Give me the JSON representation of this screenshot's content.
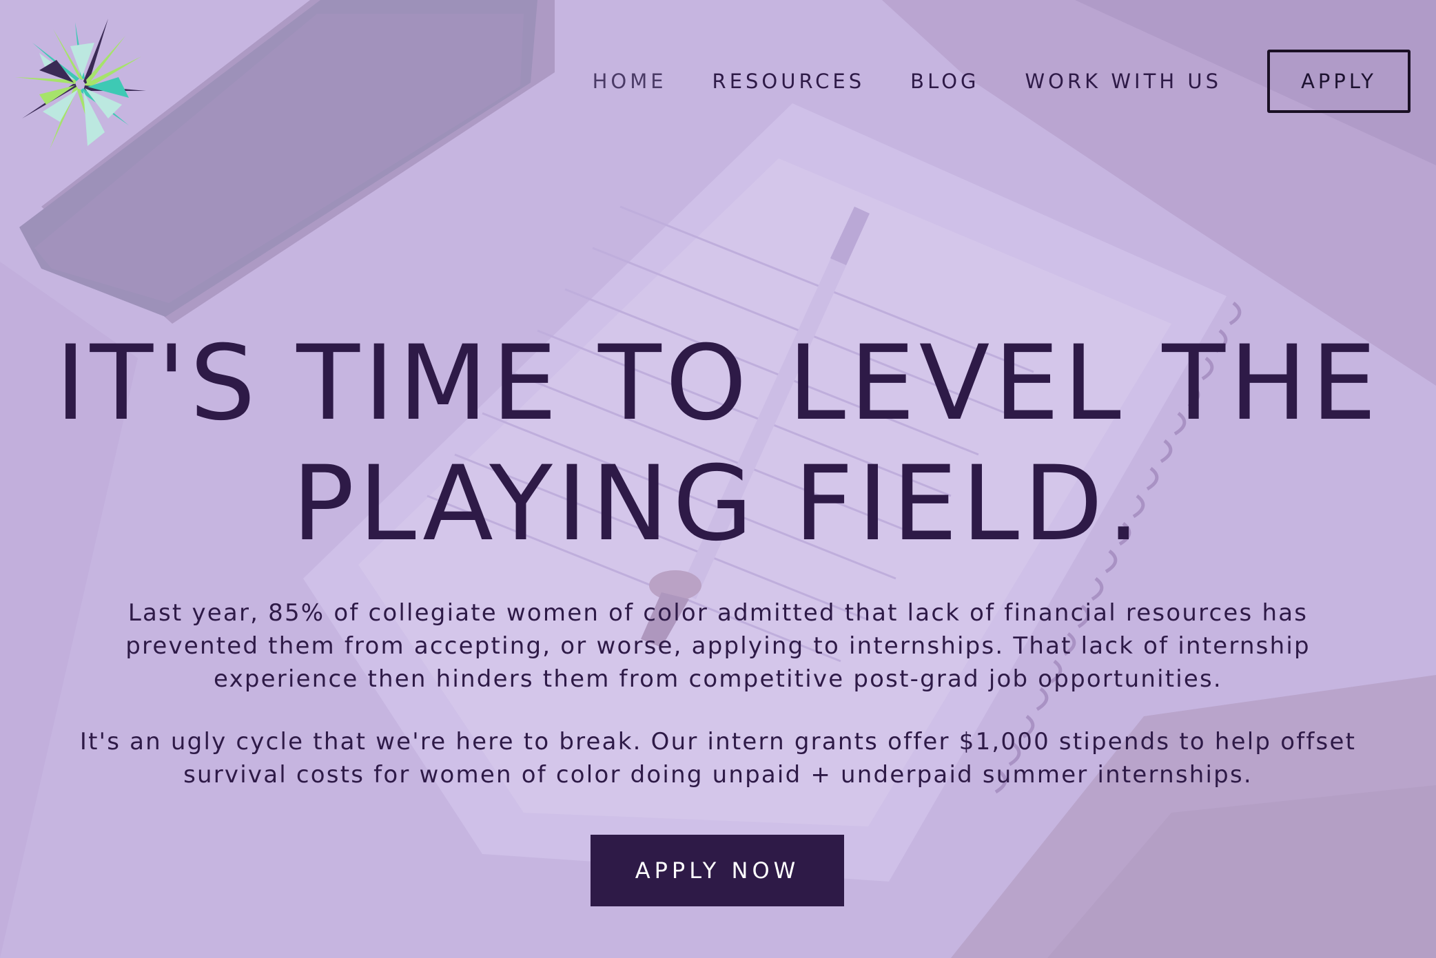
{
  "nav": {
    "items": [
      {
        "label": "HOME"
      },
      {
        "label": "RESOURCES"
      },
      {
        "label": "BLOG"
      },
      {
        "label": "WORK WITH US"
      }
    ],
    "apply_label": "APPLY"
  },
  "hero": {
    "headline_line1": "IT'S TIME TO LEVEL THE",
    "headline_line2": "PLAYING FIELD.",
    "paragraph1": "Last year, 85% of collegiate women of color admitted that lack of financial resources has prevented them from accepting, or worse, applying to internships.  That lack of internship experience then hinders them from competitive post-grad job opportunities.",
    "paragraph2": "It's an ugly cycle that we're here to break. Our intern grants offer $1,000 stipends to help offset survival costs for women of color doing unpaid + underpaid summer internships.",
    "cta_label": "APPLY NOW"
  },
  "colors": {
    "overlay": "#c4b3de",
    "text_dark_purple": "#2e1a47",
    "button_bg": "#2e1a47",
    "logo_green": "#a6e36b",
    "logo_teal": "#3ec9b4",
    "logo_dark": "#3a2a55"
  },
  "icons": {
    "logo": "starburst-logo-icon"
  }
}
